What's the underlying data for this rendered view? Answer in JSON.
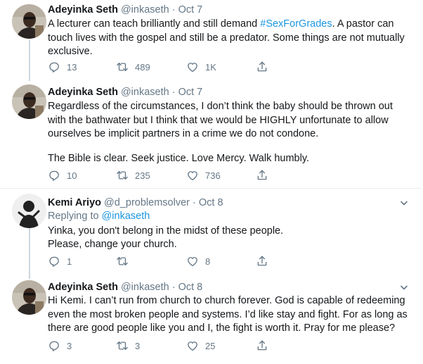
{
  "tweets": [
    {
      "name": "Adeyinka Seth",
      "handle": "@inkaseth",
      "separator": "·",
      "date": "Oct 7",
      "text_before": "A lecturer can teach brilliantly and still demand ",
      "hashtag": "#SexForGrades",
      "text_after": ". A pastor can touch lives with the gospel and still be a predator. Some things are not mutually exclusive.",
      "replies": "13",
      "retweets": "489",
      "likes": "1K"
    },
    {
      "name": "Adeyinka Seth",
      "handle": "@inkaseth",
      "separator": "·",
      "date": "Oct 7",
      "paragraph1": "Regardless of the circumstances, I don’t think the baby should be thrown out with the bathwater but I think that we would be HIGHLY unfortunate to allow ourselves be implicit partners in a crime we do not condone.",
      "paragraph2": "The Bible is clear. Seek justice. Love Mercy. Walk humbly.",
      "replies": "10",
      "retweets": "235",
      "likes": "736"
    },
    {
      "name": "Kemi Ariyo",
      "handle": "@d_problemsolver",
      "separator": "·",
      "date": "Oct 8",
      "replying_prefix": "Replying to ",
      "replying_to": "@inkaseth",
      "line1": "Yinka, you don't belong in the midst of these people.",
      "line2": "Please, change your church.",
      "replies": "1",
      "retweets": "",
      "likes": "8"
    },
    {
      "name": "Adeyinka Seth",
      "handle": "@inkaseth",
      "separator": "·",
      "date": "Oct 8",
      "text": "Hi Kemi. I can’t run from church to church forever. God is capable of redeeming even the most broken people and systems. I’d like stay and fight. For as long as there are good people like you and I, the fight is worth it. Pray for me please?",
      "replies": "3",
      "retweets": "3",
      "likes": "25"
    }
  ],
  "icons": {
    "reply": "reply-icon",
    "retweet": "retweet-icon",
    "like": "heart-icon",
    "share": "share-icon",
    "more": "chevron-down-icon"
  },
  "colors": {
    "text": "#14171a",
    "secondary": "#657786",
    "link": "#1b95e0",
    "divider": "#e6ecf0"
  }
}
